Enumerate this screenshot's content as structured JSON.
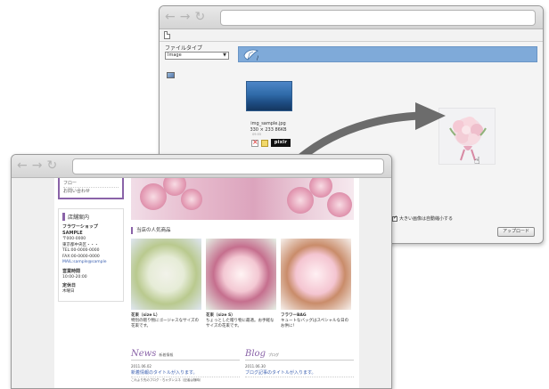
{
  "back_window": {
    "filetype_label": "ファイルタイプ",
    "filetype_value": "Image",
    "file_name": "img_sample.jpg",
    "file_meta": "330 × 233 86KB",
    "file_extra": "09:55",
    "pixlr_label": "pixlr",
    "resize_label": "大きい画像は自動縮小する",
    "upload_label": "アップロード"
  },
  "front_window": {
    "side": {
      "link_prev": "フロー",
      "link_contact": "お問い合わせ",
      "store_heading": "店舗案内",
      "store_name": "フラワーショップ SAMPLE",
      "postal": "〒000-0000",
      "address": "東京都中央区・・・",
      "tel": "TEL:00-0000-0000",
      "fax": "FAX:00-0000-0000",
      "mail": "MAIL:sample@sample",
      "hours_label": "営業時間",
      "hours_value": "10:00-20:00",
      "holiday_label": "定休日",
      "holiday_value": "木曜日"
    },
    "main": {
      "popular_heading": "当店の人気商品",
      "products": [
        {
          "name": "花束（size L）",
          "desc": "特別の贈り物にゴージャスなサイズの花束です。"
        },
        {
          "name": "花束（size S）",
          "desc": "ちょっとした贈り物に最適。お手軽なサイズの花束です。"
        },
        {
          "name": "フラワーBAG",
          "desc": "キュートなバッグはスペシャルな日のお供に！"
        }
      ],
      "news": {
        "title": "News",
        "sub": "新着情報",
        "date": "2011.06.02",
        "post": "新着情報のタイトルが入ります。",
        "post_sub": "これより先のブログ・ちゃダンスネ（記者は随時）"
      },
      "blog": {
        "title": "Blog",
        "sub": "ブログ",
        "date": "2011.06.30",
        "post": "ブログ記事のタイトルが入ります。"
      }
    }
  }
}
